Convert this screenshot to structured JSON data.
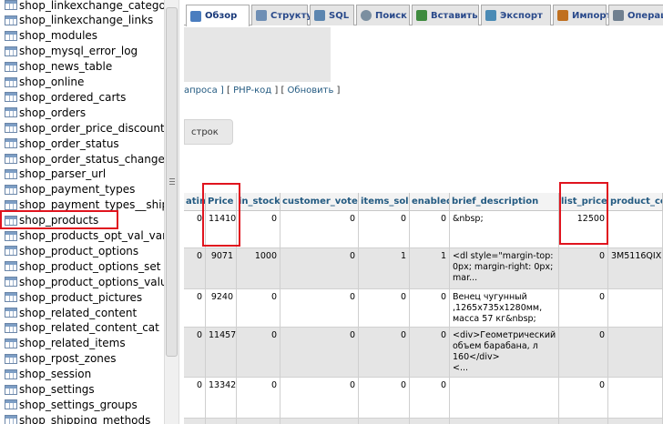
{
  "sidebar": {
    "tables": [
      "shop_linkexchange_categor",
      "shop_linkexchange_links",
      "shop_modules",
      "shop_mysql_error_log",
      "shop_news_table",
      "shop_online",
      "shop_ordered_carts",
      "shop_orders",
      "shop_order_price_discount",
      "shop_order_status",
      "shop_order_status_changelo",
      "shop_parser_url",
      "shop_payment_types",
      "shop_payment_types__shipp",
      "shop_products",
      "shop_products_opt_val_varia",
      "shop_product_options",
      "shop_product_options_set",
      "shop_product_options_value",
      "shop_product_pictures",
      "shop_related_content",
      "shop_related_content_cat",
      "shop_related_items",
      "shop_rpost_zones",
      "shop_session",
      "shop_settings",
      "shop_settings_groups",
      "shop_shipping_methods"
    ],
    "selected": "shop_products"
  },
  "tabs": [
    {
      "label": "Обзор",
      "icon": "browse-icon",
      "active": true
    },
    {
      "label": "Структура",
      "icon": "structure-icon"
    },
    {
      "label": "SQL",
      "icon": "sql-icon"
    },
    {
      "label": "Поиск",
      "icon": "search-icon"
    },
    {
      "label": "Вставить",
      "icon": "insert-icon"
    },
    {
      "label": "Экспорт",
      "icon": "export-icon"
    },
    {
      "label": "Импорт",
      "icon": "import-icon"
    },
    {
      "label": "Операции",
      "icon": "operations-icon"
    }
  ],
  "query_links": {
    "edit_fragment": "апроса ]",
    "php_code": "PHP-код",
    "refresh": "Обновить"
  },
  "rows_button": "строк",
  "table": {
    "columns": [
      "ating",
      "Price",
      "in_stock",
      "customer_votes",
      "items_sold",
      "enabled",
      "brief_description",
      "list_price",
      "product_co"
    ],
    "rows": [
      {
        "rating": "0",
        "price": "11410",
        "in_stock": "0",
        "votes": "0",
        "sold": "0",
        "enabled": "0",
        "brief": "&nbsp;",
        "list_price": "12500",
        "code": ""
      },
      {
        "rating": "0",
        "price": "9071",
        "in_stock": "1000",
        "votes": "0",
        "sold": "1",
        "enabled": "1",
        "brief": "<dl style=\"margin-top:\n0px; margin-right: 0px;\nmar...",
        "list_price": "0",
        "code": "3M5116QIX"
      },
      {
        "rating": "0",
        "price": "9240",
        "in_stock": "0",
        "votes": "0",
        "sold": "0",
        "enabled": "0",
        "brief": "Венец чугунный\n,1265x735x1280мм,\nмасса 57 кг&nbsp;",
        "list_price": "0",
        "code": ""
      },
      {
        "rating": "0",
        "price": "11457",
        "in_stock": "0",
        "votes": "0",
        "sold": "0",
        "enabled": "0",
        "brief": "<div>Геометрический\nобъем барабана, л\n160</div>\n<...",
        "list_price": "0",
        "code": ""
      },
      {
        "rating": "0",
        "price": "13342",
        "in_stock": "0",
        "votes": "0",
        "sold": "0",
        "enabled": "0",
        "brief": "",
        "list_price": "0",
        "code": ""
      },
      {
        "rating": "",
        "price": "",
        "in_stock": "",
        "votes": "",
        "sold": "",
        "enabled": "",
        "brief": "",
        "list_price": "",
        "code": ""
      }
    ]
  },
  "colors": {
    "highlight": "#e0141e",
    "link": "#235a81",
    "row_alt": "#e5e5e5"
  }
}
